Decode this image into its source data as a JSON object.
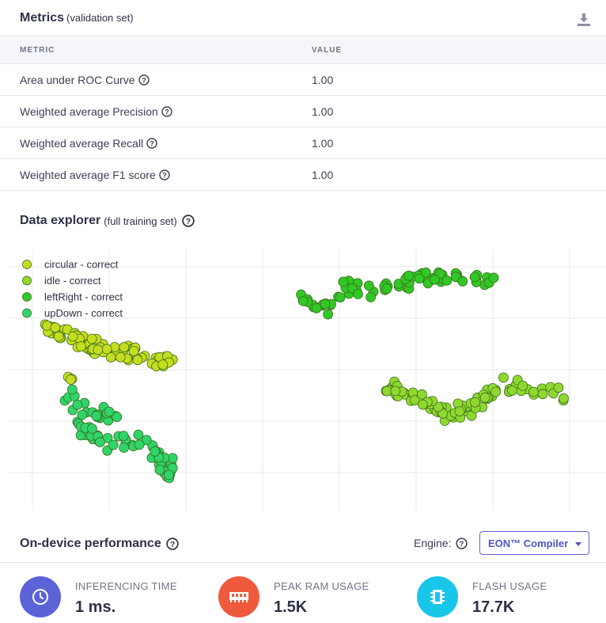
{
  "metrics": {
    "title": "Metrics",
    "subtitle": "(validation set)",
    "download_icon": "download-icon",
    "columns": {
      "metric": "METRIC",
      "value": "VALUE"
    },
    "rows": [
      {
        "name": "Area under ROC Curve",
        "value": "1.00"
      },
      {
        "name": "Weighted average Precision",
        "value": "1.00"
      },
      {
        "name": "Weighted average Recall",
        "value": "1.00"
      },
      {
        "name": "Weighted average F1 score",
        "value": "1.00"
      }
    ]
  },
  "explorer": {
    "title": "Data explorer",
    "subtitle": "(full training set)",
    "help_icon": "question-circle-icon",
    "legend": [
      {
        "label": "circular - correct",
        "color": "#c5dd1f"
      },
      {
        "label": "idle - correct",
        "color": "#8fd92f"
      },
      {
        "label": "leftRight - correct",
        "color": "#31c725"
      },
      {
        "label": "upDown - correct",
        "color": "#2fd46a"
      }
    ]
  },
  "performance": {
    "title": "On-device performance",
    "engine_label": "Engine:",
    "engine_value": "EON™ Compiler",
    "stats": [
      {
        "label": "INFERENCING TIME",
        "value": "1 ms.",
        "icon": "clock-icon",
        "color": "#5c63d6"
      },
      {
        "label": "PEAK RAM USAGE",
        "value": "1.5K",
        "icon": "ram-chip-icon",
        "color": "#f05a3c"
      },
      {
        "label": "FLASH USAGE",
        "value": "17.7K",
        "icon": "flash-chip-icon",
        "color": "#17c6e8"
      }
    ]
  }
}
